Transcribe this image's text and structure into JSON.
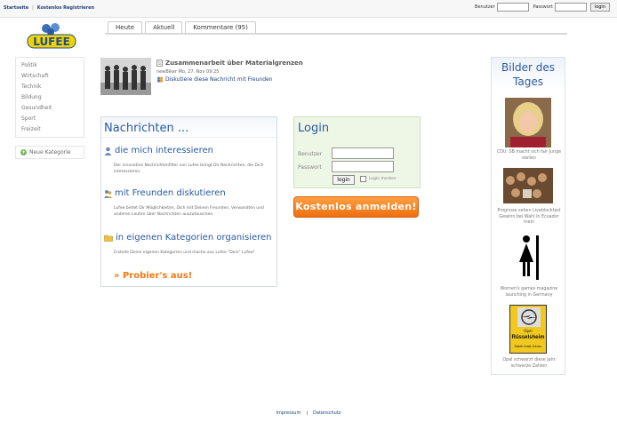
{
  "topbar": {
    "links": [
      "Startseite",
      "Kostenlos Registrieren"
    ],
    "login": {
      "user_label": "Benutzer",
      "pass_label": "Passwort",
      "button": "login"
    }
  },
  "logo": {
    "text": "LUFEE"
  },
  "tabs": [
    "Heute",
    "Aktuell",
    "Kommentare (95)"
  ],
  "sidebar": {
    "items": [
      "Politik",
      "Wirtschaft",
      "Technik",
      "Bildung",
      "Gesundheit",
      "Sport",
      "Freizeit"
    ],
    "new_category": "Neue Kategorie"
  },
  "news": {
    "title": "Zusammenarbeit über Materialgrenzen",
    "meta": "newBiker Mo, 27. Nov 09:25",
    "discuss": "Diskutiere diese Nachricht mit Freunden"
  },
  "nachrichten": {
    "title": "Nachrichten ...",
    "features": [
      {
        "title": "die mich interessieren",
        "desc": "Der innovative Nachrichtenfilter von Lufee bringt Dir Nachrichten, die Dich interessieren."
      },
      {
        "title": "mit Freunden diskutieren",
        "desc": "Lufee bietet Dir Möglichkeiten, Dich mit Deinen Freunden, Verwandten und anderen Leuten über Nachrichten auszutauschen."
      },
      {
        "title": "in eigenen Kategorien organisieren",
        "desc": "Erstelle Deine eigenen Kategorien und mache aus Lufee \"Dein\" Lufee!"
      }
    ],
    "cta": "» Probier's aus!"
  },
  "login": {
    "title": "Login",
    "user_label": "Benutzer",
    "pass_label": "Passwort",
    "button": "login",
    "remember": "Login merken"
  },
  "register_button": "Kostenlos anmelden!",
  "bilder": {
    "title_line1": "Bilder des",
    "title_line2": "Tages",
    "captions": [
      "CDU: SB macht sich fair Junge stellen",
      "Prognose sehen Liveblockfast Gewinn bei Wahl in Ecuador mein",
      "Women's games magazine launching in Germany",
      "Opel schwärzt diese Jahr schwarze Zahlen"
    ],
    "sign_text": [
      "Opel",
      "Rüsselsheim",
      "Stadt Groß-Gerau"
    ]
  },
  "footer": {
    "links": [
      "Impressum",
      "Datenschutz"
    ]
  },
  "colors": {
    "accent": "#2a5aa0",
    "orange": "#ee6f10",
    "login_bg": "#eef6e6"
  }
}
